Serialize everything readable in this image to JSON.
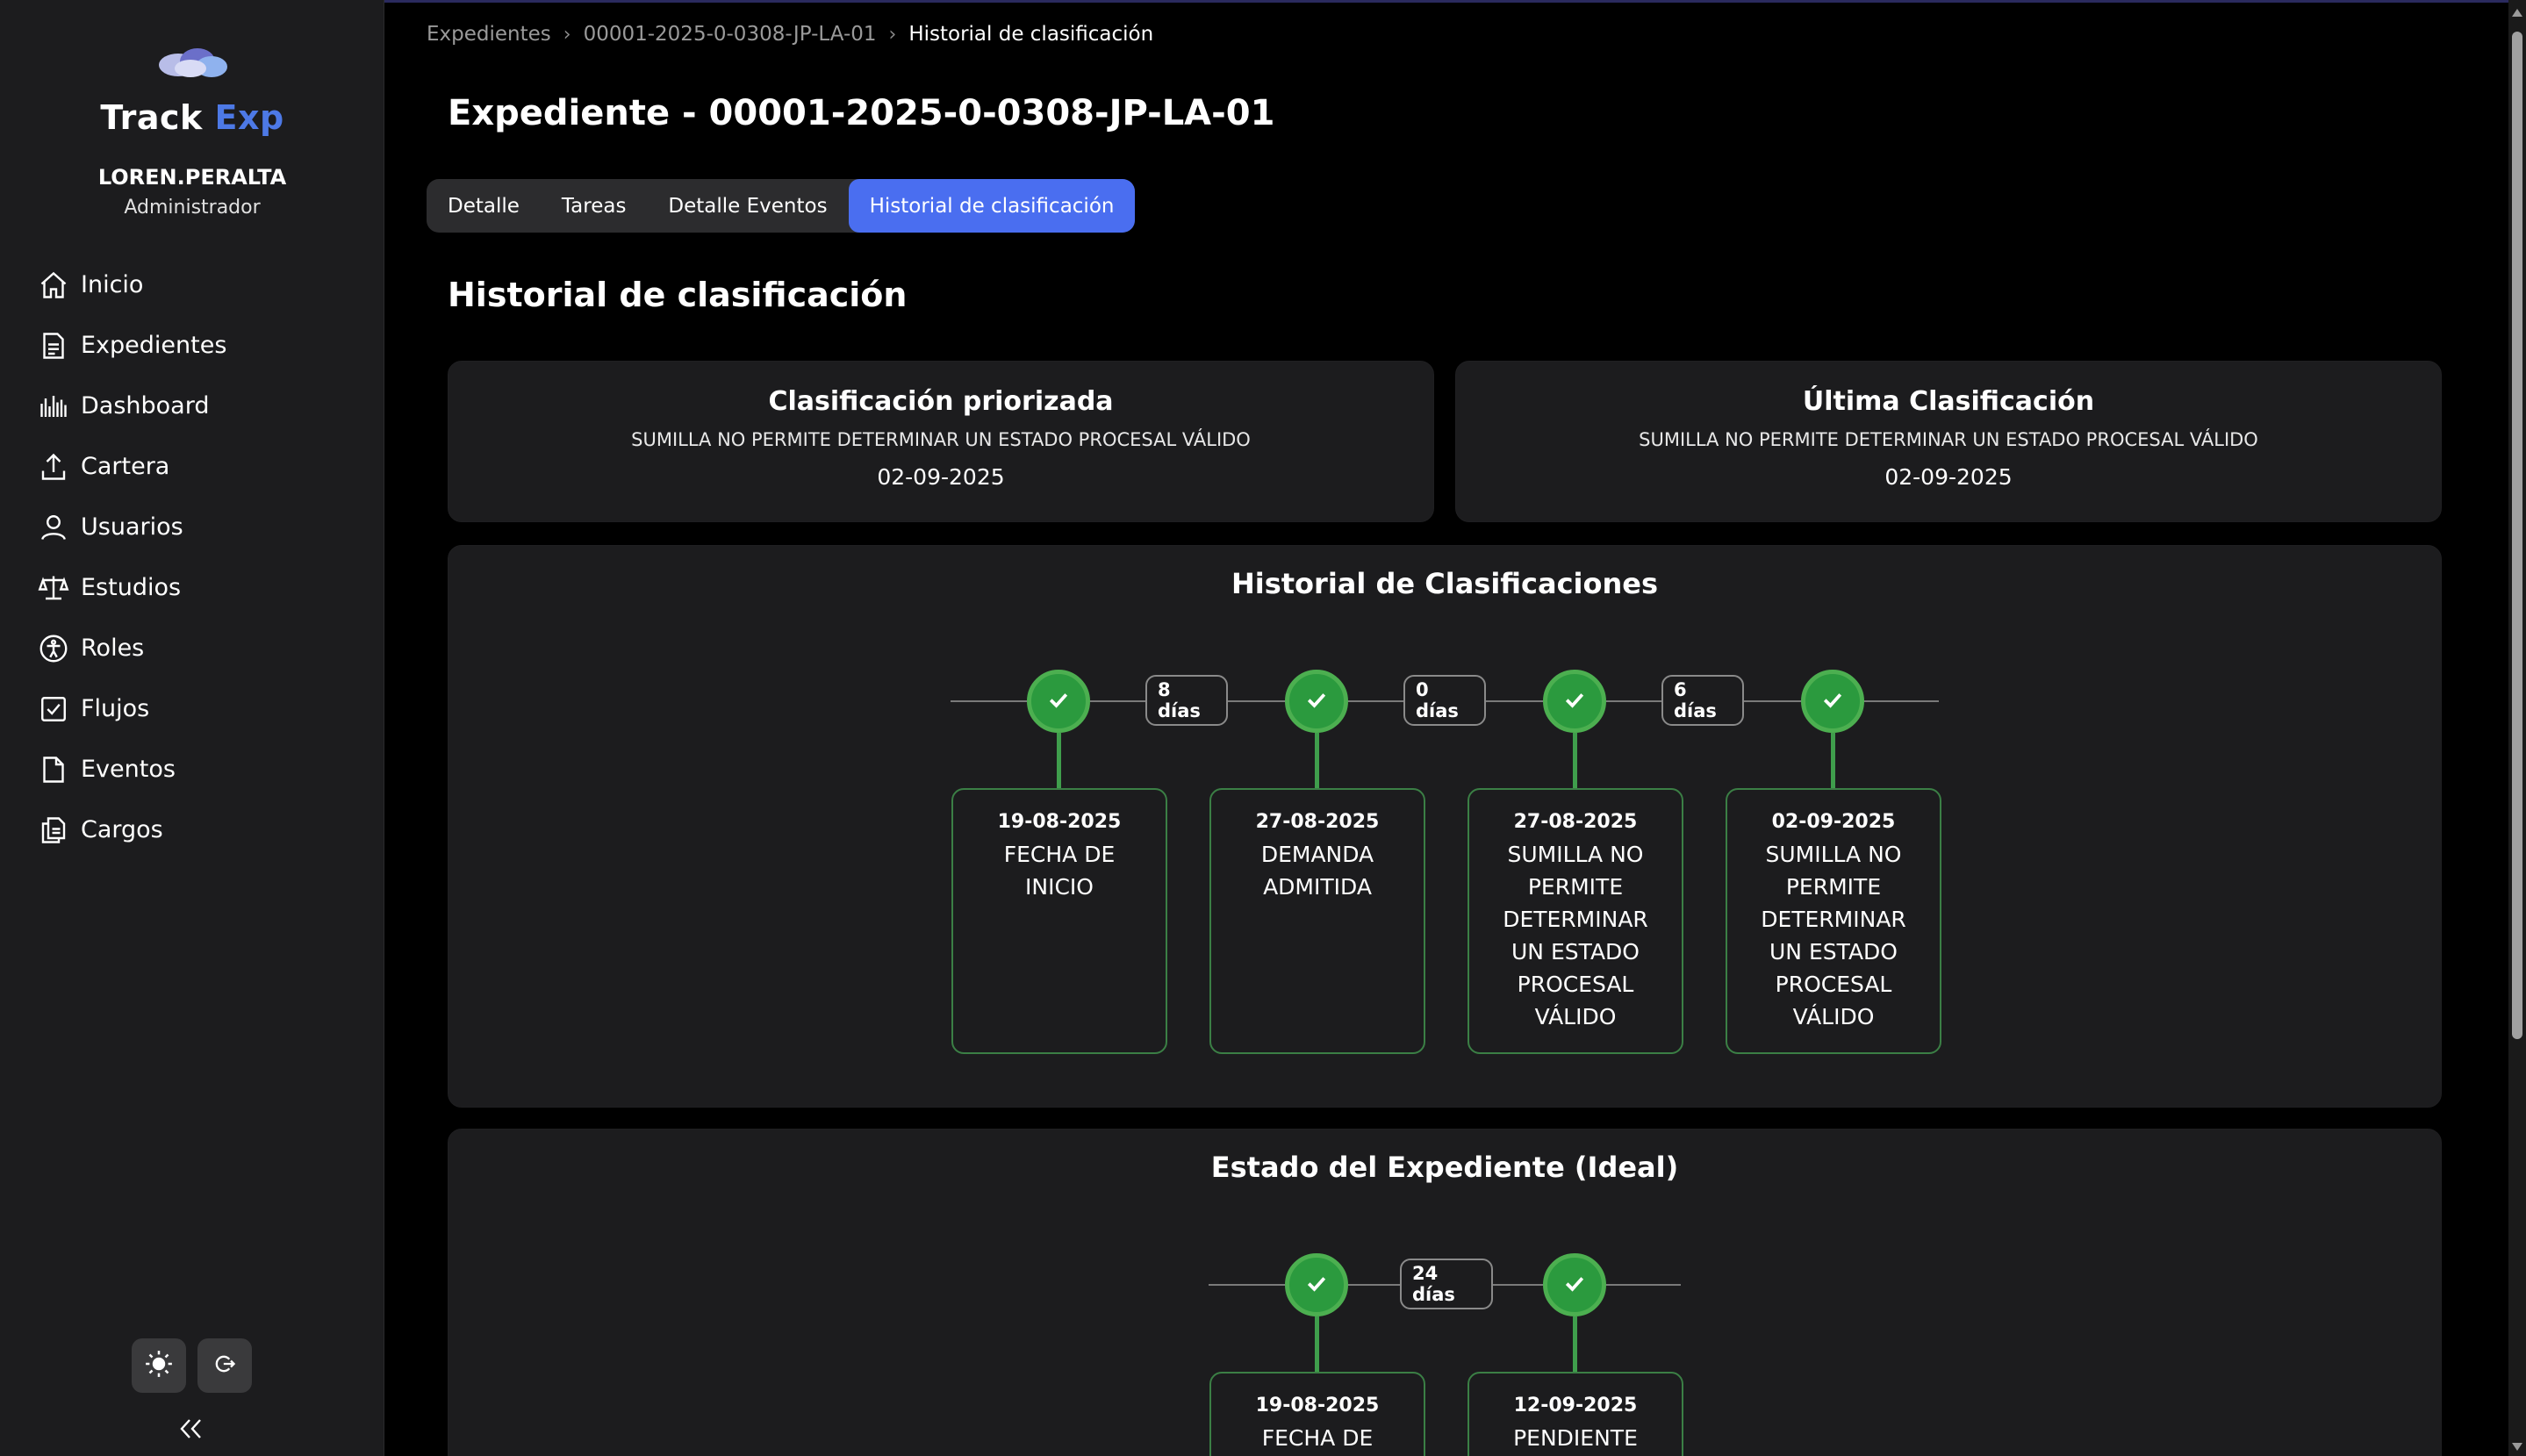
{
  "brand": {
    "part1": "Track",
    "part2": " Exp",
    "accent": "#4d79e6"
  },
  "user": {
    "name": "LOREN.PERALTA",
    "role": "Administrador"
  },
  "nav": [
    {
      "label": "Inicio",
      "icon": "home-icon"
    },
    {
      "label": "Expedientes",
      "icon": "document-list-icon"
    },
    {
      "label": "Dashboard",
      "icon": "bar-chart-icon"
    },
    {
      "label": "Cartera",
      "icon": "upload-icon"
    },
    {
      "label": "Usuarios",
      "icon": "user-icon"
    },
    {
      "label": "Estudios",
      "icon": "scales-icon"
    },
    {
      "label": "Roles",
      "icon": "accessibility-icon"
    },
    {
      "label": "Flujos",
      "icon": "checkbox-icon"
    },
    {
      "label": "Eventos",
      "icon": "file-icon"
    },
    {
      "label": "Cargos",
      "icon": "files-icon"
    }
  ],
  "breadcrumb": [
    "Expedientes",
    "00001-2025-0-0308-JP-LA-01",
    "Historial de clasificación"
  ],
  "page_title": "Expediente - 00001-2025-0-0308-JP-LA-01",
  "tabs": [
    {
      "label": "Detalle",
      "active": false
    },
    {
      "label": "Tareas",
      "active": false
    },
    {
      "label": "Detalle Eventos",
      "active": false
    },
    {
      "label": "Historial de clasificación",
      "active": true
    }
  ],
  "section_title": "Historial de clasificación",
  "summary": {
    "priorizada": {
      "title": "Clasificación priorizada",
      "desc": "SUMILLA NO PERMITE DETERMINAR UN ESTADO PROCESAL VÁLIDO",
      "date": "02-09-2025"
    },
    "ultima": {
      "title": "Última Clasificación",
      "desc": "SUMILLA NO PERMITE DETERMINAR UN ESTADO PROCESAL VÁLIDO",
      "date": "02-09-2025"
    }
  },
  "historial": {
    "title": "Historial de Clasificaciones",
    "events": [
      {
        "date": "19-08-2025",
        "label": "FECHA DE INICIO"
      },
      {
        "date": "27-08-2025",
        "label": "DEMANDA ADMITIDA"
      },
      {
        "date": "27-08-2025",
        "label": "SUMILLA NO PERMITE DETERMINAR UN ESTADO PROCESAL VÁLIDO"
      },
      {
        "date": "02-09-2025",
        "label": "SUMILLA NO PERMITE DETERMINAR UN ESTADO PROCESAL VÁLIDO"
      }
    ],
    "gaps": [
      "8 días",
      "0 días",
      "6 días"
    ]
  },
  "ideal": {
    "title": "Estado del Expediente (Ideal)",
    "events": [
      {
        "date": "19-08-2025",
        "label": "FECHA DE INICIO"
      },
      {
        "date": "12-09-2025",
        "label": "PENDIENTE"
      }
    ],
    "gaps": [
      "24 días"
    ]
  },
  "colors": {
    "active_tab": "#4a6ef0",
    "node_green": "#4caf50",
    "card_bg": "#1c1c1e"
  }
}
